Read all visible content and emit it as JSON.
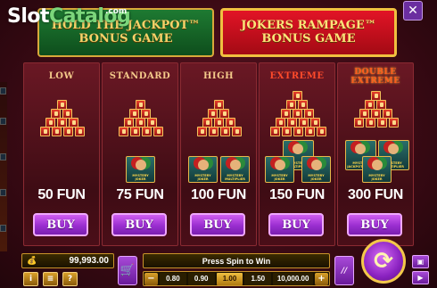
{
  "watermark": {
    "brand_a": "Slot",
    "brand_b": "Catalog",
    "domain": ".com"
  },
  "banners": {
    "left": {
      "line1": "HOLD THE JACKPOT™",
      "line2": "BONUS GAME"
    },
    "right": {
      "line1": "JOKERS RAMPAGE™",
      "line2": "BONUS GAME"
    }
  },
  "close_label": "✕",
  "panels": [
    {
      "name": "LOW",
      "value": "50 FUN",
      "buy": "BUY",
      "cards": []
    },
    {
      "name": "STANDARD",
      "value": "75 FUN",
      "buy": "BUY",
      "cards": [
        "MYSTERY JOKER"
      ]
    },
    {
      "name": "HIGH",
      "value": "100 FUN",
      "buy": "BUY",
      "cards": [
        "MYSTERY JOKER",
        "MYSTERY MULTIPLIER"
      ]
    },
    {
      "name": "EXTREME",
      "value": "150 FUN",
      "buy": "BUY",
      "cards": [
        "MYSTERY JOKER",
        "MYSTERY MULTIPLIER",
        "MYSTERY JOKER"
      ]
    },
    {
      "name_line1": "DOUBLE",
      "name_line2": "EXTREME",
      "value": "300 FUN",
      "buy": "BUY",
      "cards": [
        "MYSTERY JACKPOT JOKER",
        "MYSTERY MULTIPLIER",
        "MYSTERY JOKER"
      ]
    }
  ],
  "bottombar": {
    "balance": "99,993.00",
    "balance_icon": "💰",
    "status": "Press Spin to Win",
    "bet_options": [
      "0.80",
      "0.90",
      "1.00",
      "1.50",
      "10,000.00"
    ],
    "bet_selected": "1.00",
    "minus": "−",
    "plus": "+",
    "info_icon": "i",
    "menu_icon": "≡",
    "help_icon": "?",
    "cart_icon": "🛒",
    "auto_label": "//",
    "spin_icon": "⟳",
    "screen_icon": "▣",
    "play_icon": "▶"
  }
}
